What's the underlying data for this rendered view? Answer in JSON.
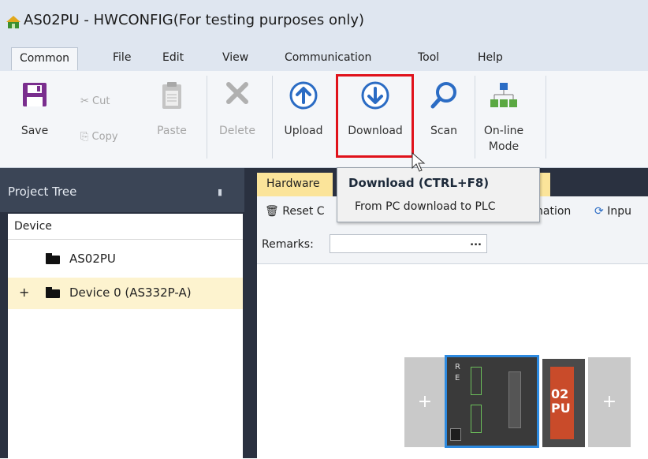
{
  "window": {
    "title": "AS02PU - HWCONFIG(For testing purposes only)"
  },
  "menu": [
    "Common",
    "File",
    "Edit",
    "View",
    "Communication",
    "Tool",
    "Help"
  ],
  "ribbon": {
    "save": "Save",
    "cut": "Cut",
    "copy": "Copy",
    "paste": "Paste",
    "delete": "Delete",
    "upload": "Upload",
    "download": "Download",
    "scan": "Scan",
    "online_line1": "On-line",
    "online_line2": "Mode"
  },
  "project_tree": {
    "title": "Project Tree",
    "header": "Device",
    "items": [
      {
        "label": "AS02PU",
        "expand": ""
      },
      {
        "label": "Device 0 (AS332P-A)",
        "expand": "+"
      }
    ]
  },
  "editor": {
    "tab_hardware": "Hardware",
    "reset_label": "Reset C",
    "info_label": "nation",
    "input_label": "Inpu",
    "remarks_label": "Remarks:",
    "remarks_value": "",
    "remarks_more": "...",
    "module_leds": [
      "R",
      "E"
    ],
    "module_label_top": "02",
    "module_label_bottom": "PU",
    "slot_plus": "+"
  },
  "tooltip": {
    "title": "Download (CTRL+F8)",
    "description": "From PC download to PLC"
  },
  "colors": {
    "accent_blue": "#2b6cc4",
    "highlight_red": "#e0121b",
    "save_purple": "#7a2e8e",
    "tab_yellow": "#fbe49a",
    "dark_frame": "#2a3140"
  }
}
